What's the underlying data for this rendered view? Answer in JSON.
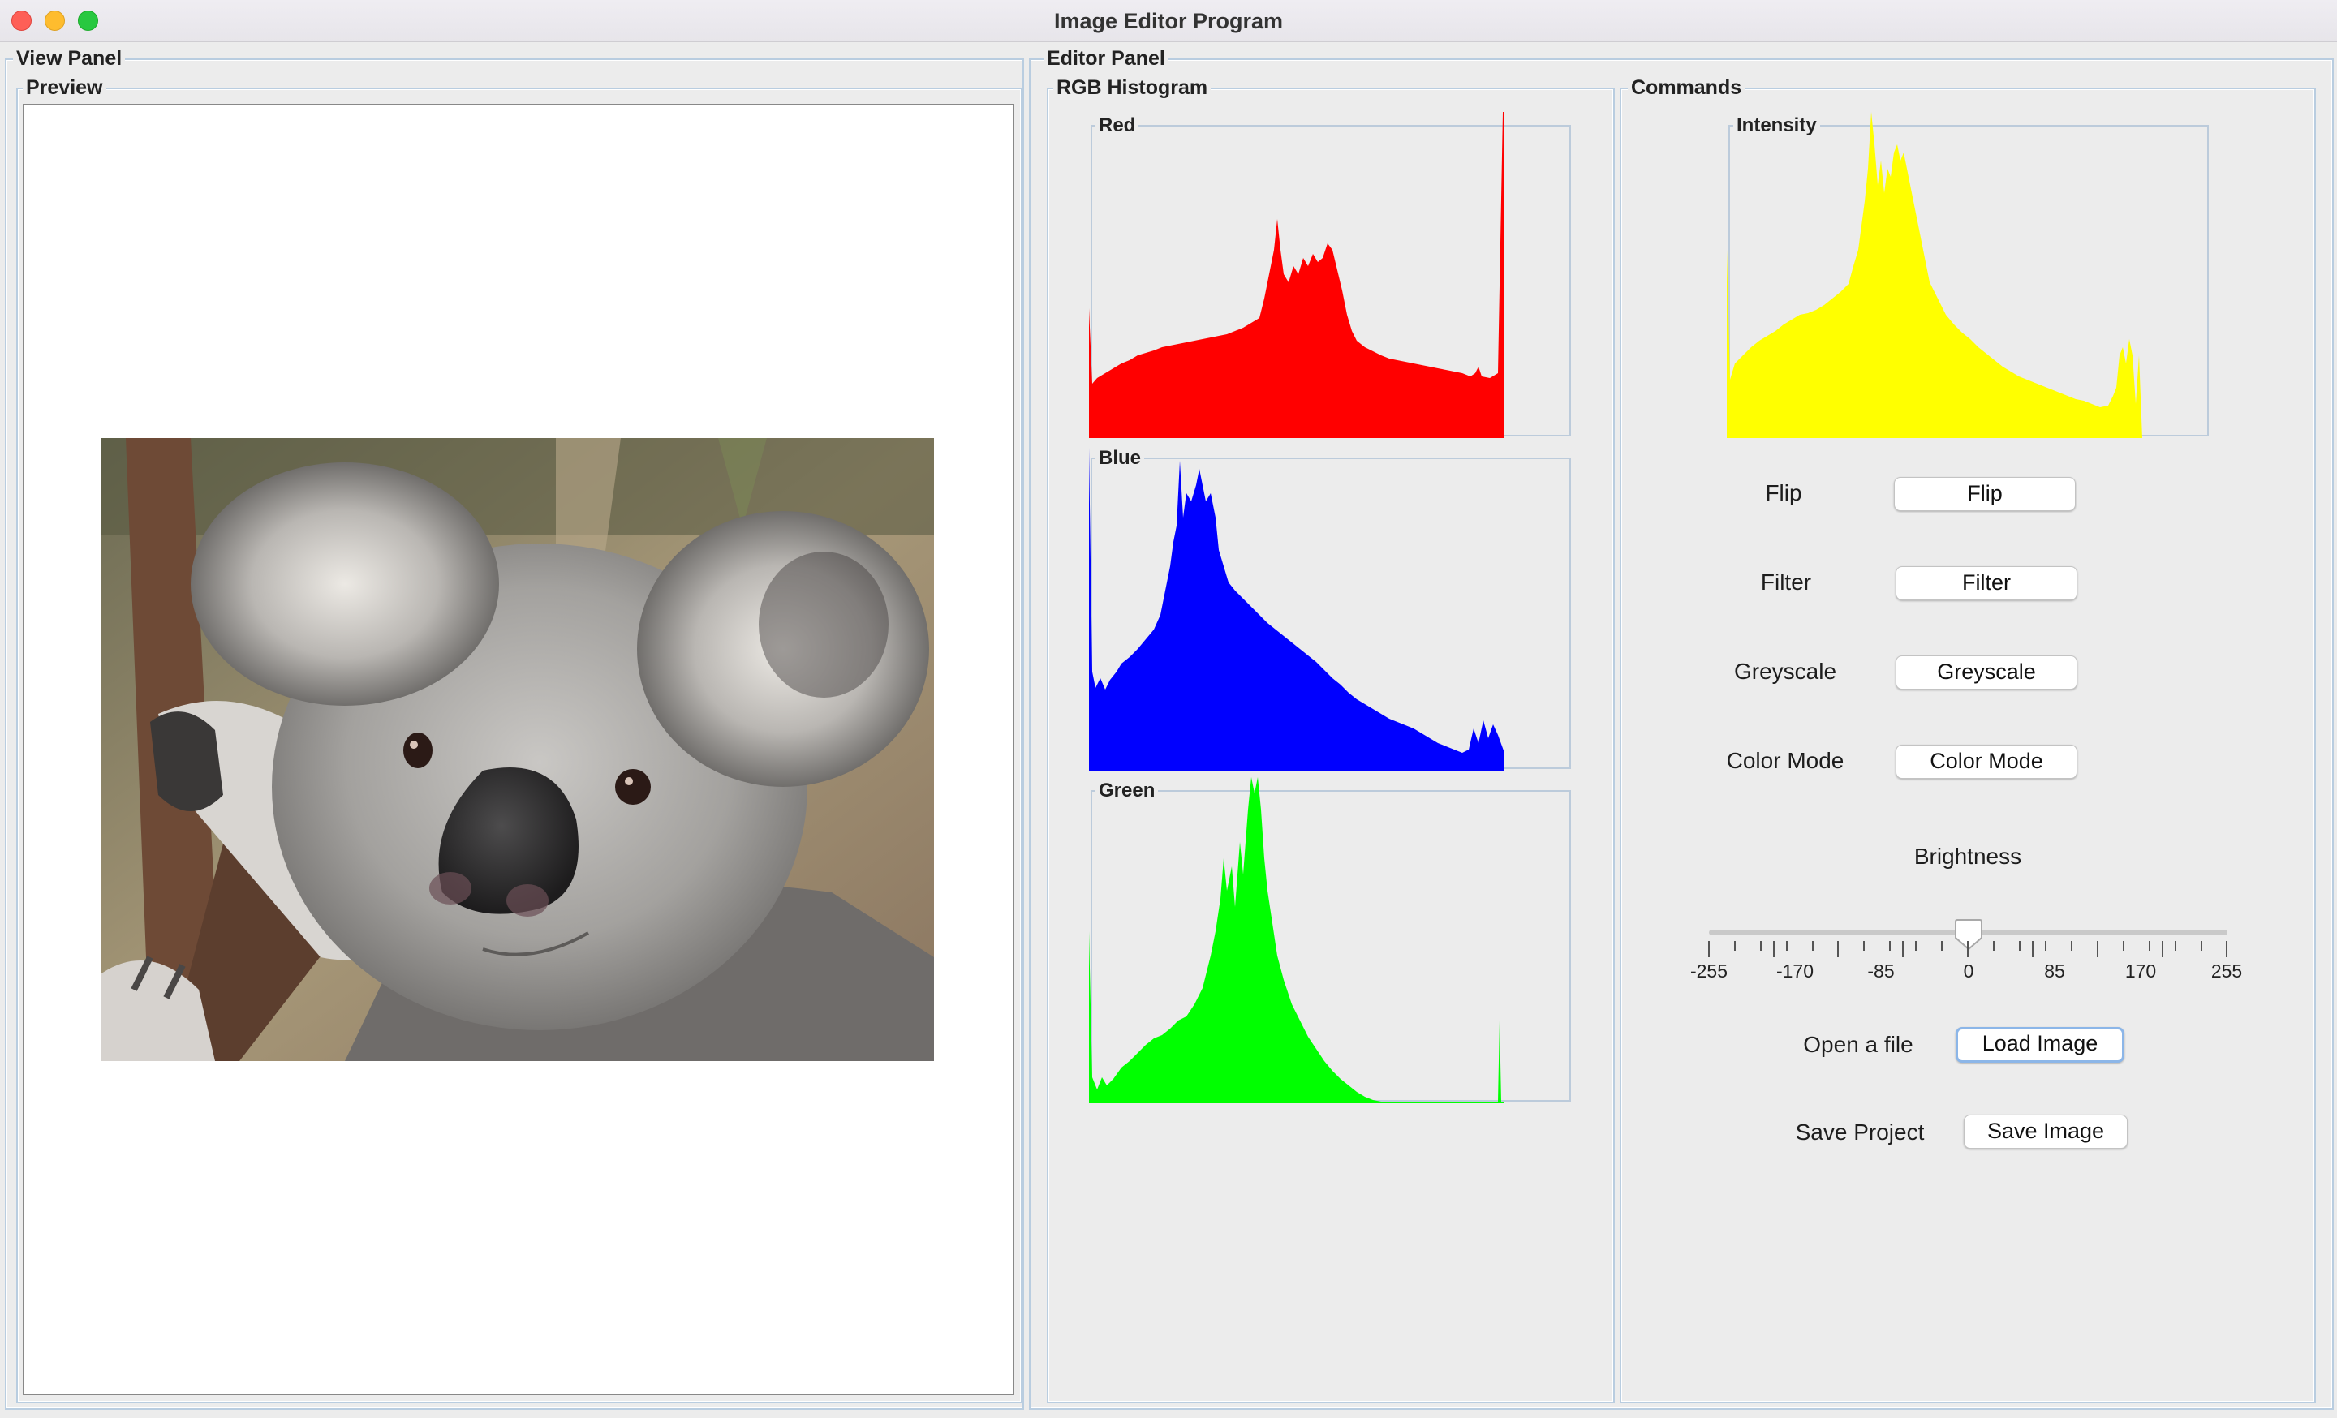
{
  "window": {
    "title": "Image Editor Program"
  },
  "view_panel": {
    "label": "View Panel",
    "preview": {
      "label": "Preview"
    }
  },
  "editor_panel": {
    "label": "Editor Panel",
    "rgb_histogram": {
      "label": "RGB Histogram",
      "red": {
        "label": "Red",
        "color": "#ff0000"
      },
      "blue": {
        "label": "Blue",
        "color": "#0000ff"
      },
      "green": {
        "label": "Green",
        "color": "#00ff00"
      }
    },
    "commands": {
      "label": "Commands",
      "intensity": {
        "label": "Intensity",
        "color": "#ffff00"
      },
      "flip": {
        "label": "Flip",
        "button": "Flip"
      },
      "filter": {
        "label": "Filter",
        "button": "Filter"
      },
      "greyscale": {
        "label": "Greyscale",
        "button": "Greyscale"
      },
      "color_mode": {
        "label": "Color Mode",
        "button": "Color Mode"
      },
      "brightness": {
        "label": "Brightness",
        "value": 0,
        "min": -255,
        "max": 255,
        "ticks": [
          "-255",
          "-170",
          "-85",
          "0",
          "85",
          "170",
          "255"
        ]
      },
      "open_file": {
        "label": "Open a file",
        "button": "Load Image"
      },
      "save_project": {
        "label": "Save Project",
        "button": "Save Image"
      }
    }
  },
  "colors": {
    "panel_bg": "#ececec",
    "group_border": "#b9cde0",
    "focus_ring": "#8cb6e8"
  }
}
